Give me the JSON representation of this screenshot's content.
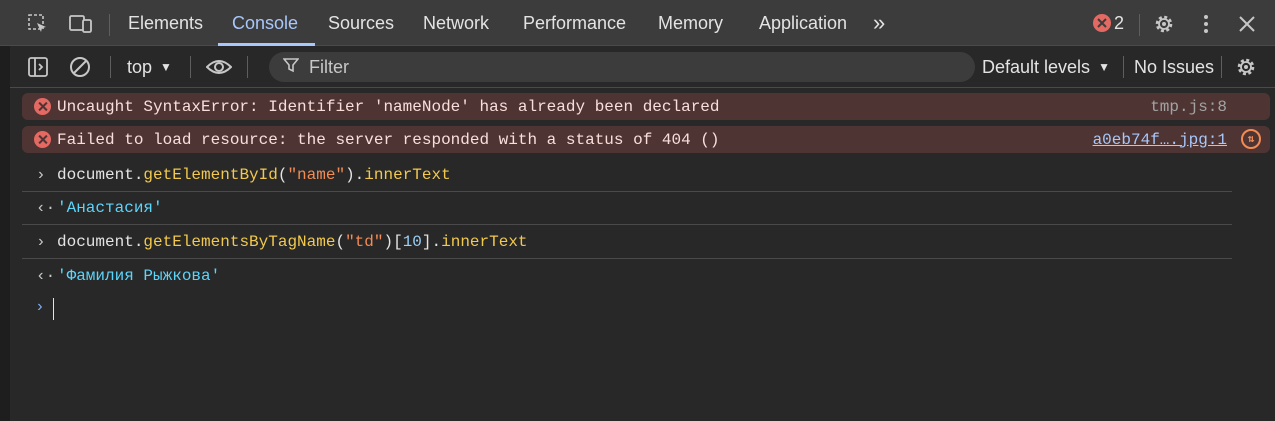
{
  "tabs": [
    "Elements",
    "Console",
    "Sources",
    "Network",
    "Performance",
    "Memory",
    "Application"
  ],
  "active_tab": "Console",
  "tabbar": {
    "more_tabs": "»",
    "error_count": "2"
  },
  "toolbar": {
    "context": "top",
    "filter_placeholder": "Filter",
    "levels": "Default levels",
    "issues": "No Issues"
  },
  "messages": [
    {
      "type": "error",
      "text": "Uncaught SyntaxError: Identifier 'nameNode' has already been declared",
      "source": "tmp.js:8"
    },
    {
      "type": "error",
      "text": "Failed to load resource: the server responded with a status of 404 ()",
      "source": "a0eb74f….jpg:1"
    }
  ],
  "entries": [
    {
      "input": {
        "obj": "document",
        "dot1": ".",
        "method": "getElementById",
        "open": "(",
        "arg": "\"name\"",
        "close": ")",
        "dot2": ".",
        "prop": "innerText"
      },
      "output": "'Анастасия'"
    },
    {
      "input": {
        "obj": "document",
        "dot1": ".",
        "method": "getElementsByTagName",
        "open": "(",
        "arg": "\"td\"",
        "close": ")",
        "index_open": "[",
        "index": "10",
        "index_close": "]",
        "dot2": ".",
        "prop": "innerText"
      },
      "output": "'Фамилия Рыжкова'"
    }
  ],
  "colors": {
    "accent": "#a8c7fa",
    "error_bg": "#4e3534",
    "error_icon": "#e46962",
    "string": "#f28b54",
    "method": "#f2c94c",
    "result": "#5cd5fb"
  }
}
